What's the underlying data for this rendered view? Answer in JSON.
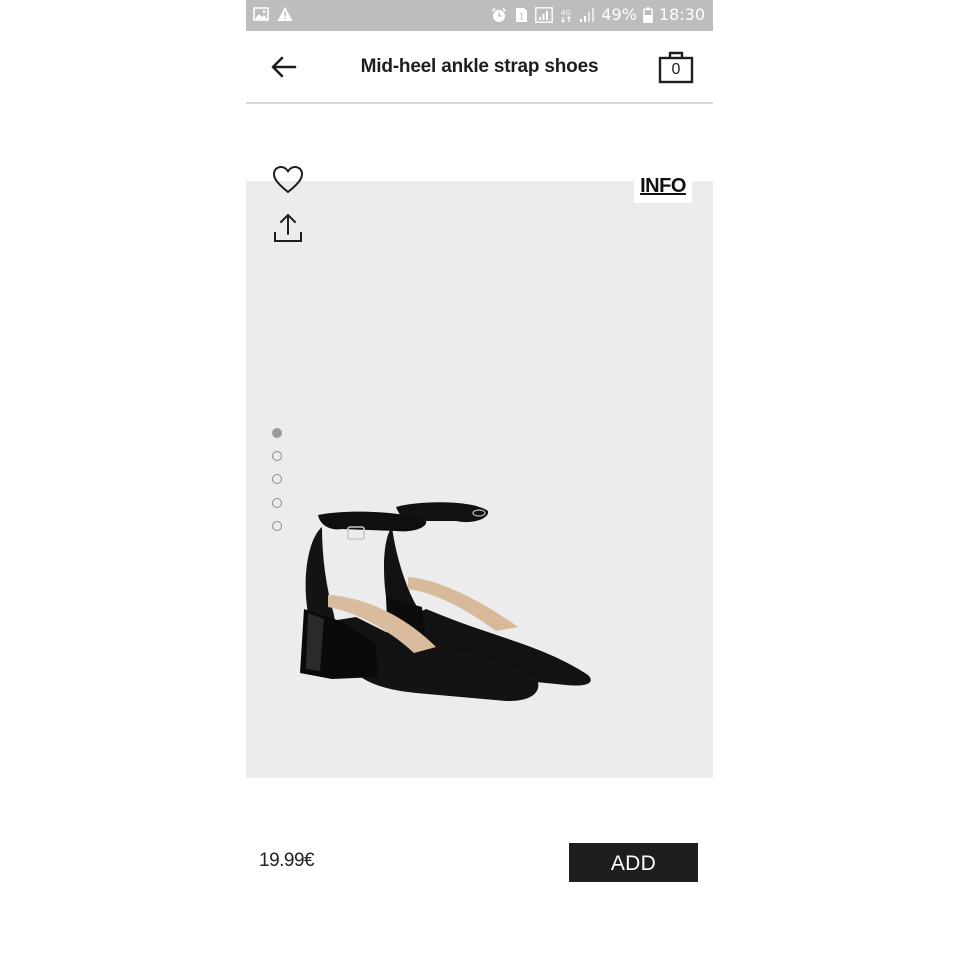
{
  "status_bar": {
    "battery_percent": "49%",
    "time": "18:30",
    "left_icons": [
      "gallery-icon",
      "warning-icon"
    ],
    "right_icons": [
      "alarm-icon",
      "sim-icon",
      "signal-box-icon",
      "network-4g-icon",
      "signal-bars-icon",
      "battery-icon"
    ]
  },
  "header": {
    "title": "Mid-heel ankle strap shoes",
    "cart_count": "0",
    "back_icon": "arrow-left-icon",
    "cart_icon": "shopping-bag-icon"
  },
  "product": {
    "info_label": "INFO",
    "wishlist_icon": "heart-icon",
    "share_icon": "share-icon",
    "image_dots": [
      {
        "active": true
      },
      {
        "active": false
      },
      {
        "active": false
      },
      {
        "active": false
      },
      {
        "active": false
      }
    ],
    "background_color": "#ececec"
  },
  "footer": {
    "price": "19.99€",
    "add_label": "ADD",
    "button_color": "#1e1e1e"
  }
}
